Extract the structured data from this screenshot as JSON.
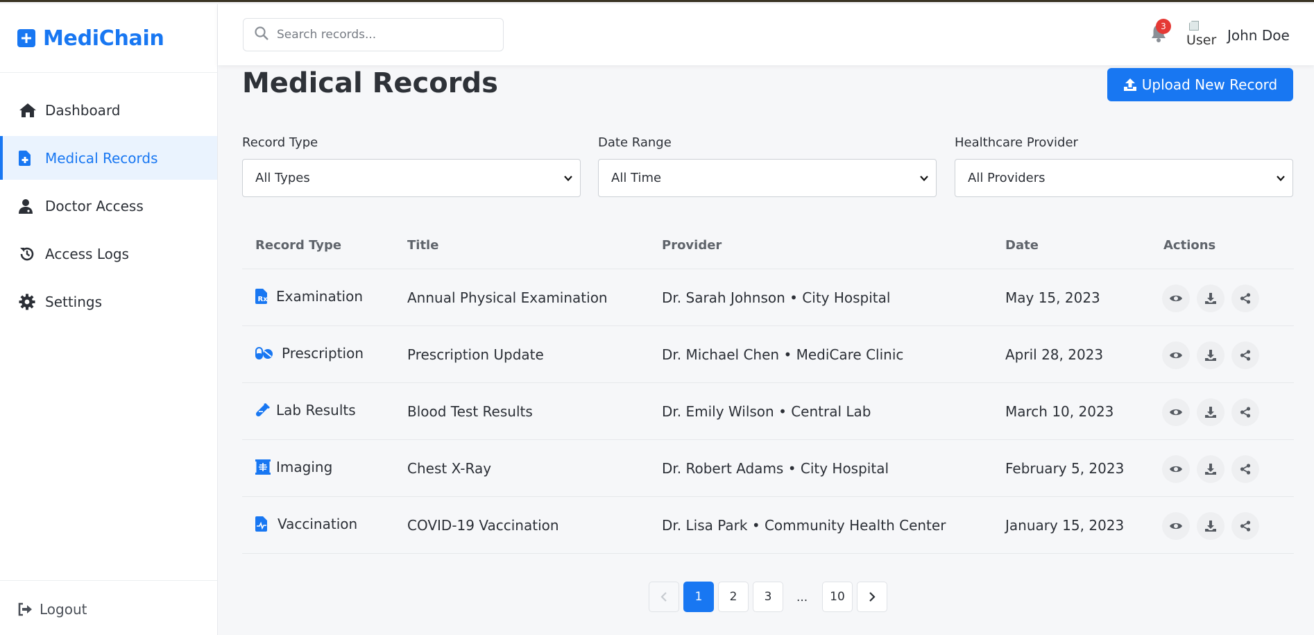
{
  "brand": {
    "name": "MediChain",
    "accent": "#1877f2"
  },
  "sidebar": {
    "items": [
      {
        "label": "Dashboard",
        "icon": "home-icon"
      },
      {
        "label": "Medical Records",
        "icon": "file-medical-icon",
        "active": true
      },
      {
        "label": "Doctor Access",
        "icon": "doctor-icon"
      },
      {
        "label": "Access Logs",
        "icon": "history-icon"
      },
      {
        "label": "Settings",
        "icon": "gear-icon"
      }
    ],
    "logout_label": "Logout"
  },
  "header": {
    "search_placeholder": "Search records...",
    "notification_count": "3",
    "avatar_alt": "User",
    "username": "John Doe"
  },
  "page": {
    "title": "Medical Records",
    "upload_label": "Upload New Record"
  },
  "filters": [
    {
      "label": "Record Type",
      "value": "All Types"
    },
    {
      "label": "Date Range",
      "value": "All Time"
    },
    {
      "label": "Healthcare Provider",
      "value": "All Providers"
    }
  ],
  "table": {
    "columns": [
      "Record Type",
      "Title",
      "Provider",
      "Date",
      "Actions"
    ],
    "rows": [
      {
        "type": "Examination",
        "icon": "prescription-file-icon",
        "title": "Annual Physical Examination",
        "provider": "Dr. Sarah Johnson • City Hospital",
        "date": "May 15, 2023"
      },
      {
        "type": "Prescription",
        "icon": "pills-icon",
        "title": "Prescription Update",
        "provider": "Dr. Michael Chen • MediCare Clinic",
        "date": "April 28, 2023"
      },
      {
        "type": "Lab Results",
        "icon": "vial-icon",
        "title": "Blood Test Results",
        "provider": "Dr. Emily Wilson • Central Lab",
        "date": "March 10, 2023"
      },
      {
        "type": "Imaging",
        "icon": "x-ray-icon",
        "title": "Chest X-Ray",
        "provider": "Dr. Robert Adams • City Hospital",
        "date": "February 5, 2023"
      },
      {
        "type": "Vaccination",
        "icon": "file-waveform-icon",
        "title": "COVID-19 Vaccination",
        "provider": "Dr. Lisa Park • Community Health Center",
        "date": "January 15, 2023"
      }
    ],
    "actions": [
      "view-icon",
      "download-icon",
      "share-icon"
    ]
  },
  "pagination": {
    "pages": [
      "1",
      "2",
      "3"
    ],
    "ellipsis": "...",
    "last": "10",
    "current": "1"
  }
}
